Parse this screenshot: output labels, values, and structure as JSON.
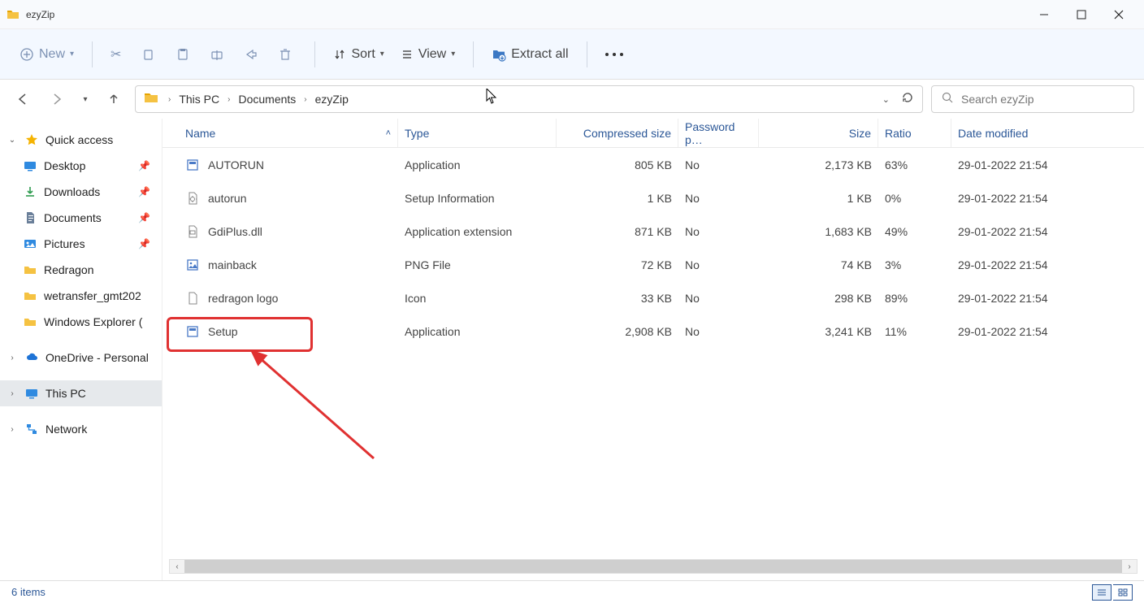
{
  "window": {
    "title": "ezyZip"
  },
  "toolbar": {
    "new": "New",
    "sort": "Sort",
    "view": "View",
    "extract": "Extract all"
  },
  "breadcrumb": {
    "parts": [
      "This PC",
      "Documents",
      "ezyZip"
    ]
  },
  "search": {
    "placeholder": "Search ezyZip"
  },
  "sidebar": {
    "quick_access": "Quick access",
    "desktop": "Desktop",
    "downloads": "Downloads",
    "documents": "Documents",
    "pictures": "Pictures",
    "redragon": "Redragon",
    "wetransfer": "wetransfer_gmt202",
    "explorer": "Windows Explorer (",
    "onedrive": "OneDrive - Personal",
    "this_pc": "This PC",
    "network": "Network"
  },
  "columns": {
    "name": "Name",
    "type": "Type",
    "csize": "Compressed size",
    "pwd": "Password p…",
    "size": "Size",
    "ratio": "Ratio",
    "date": "Date modified"
  },
  "files": [
    {
      "name": "AUTORUN",
      "type": "Application",
      "csize": "805 KB",
      "pwd": "No",
      "size": "2,173 KB",
      "ratio": "63%",
      "date": "29-01-2022 21:54"
    },
    {
      "name": "autorun",
      "type": "Setup Information",
      "csize": "1 KB",
      "pwd": "No",
      "size": "1 KB",
      "ratio": "0%",
      "date": "29-01-2022 21:54"
    },
    {
      "name": "GdiPlus.dll",
      "type": "Application extension",
      "csize": "871 KB",
      "pwd": "No",
      "size": "1,683 KB",
      "ratio": "49%",
      "date": "29-01-2022 21:54"
    },
    {
      "name": "mainback",
      "type": "PNG File",
      "csize": "72 KB",
      "pwd": "No",
      "size": "74 KB",
      "ratio": "3%",
      "date": "29-01-2022 21:54"
    },
    {
      "name": "redragon logo",
      "type": "Icon",
      "csize": "33 KB",
      "pwd": "No",
      "size": "298 KB",
      "ratio": "89%",
      "date": "29-01-2022 21:54"
    },
    {
      "name": "Setup",
      "type": "Application",
      "csize": "2,908 KB",
      "pwd": "No",
      "size": "3,241 KB",
      "ratio": "11%",
      "date": "29-01-2022 21:54"
    }
  ],
  "status": {
    "items": "6 items"
  }
}
